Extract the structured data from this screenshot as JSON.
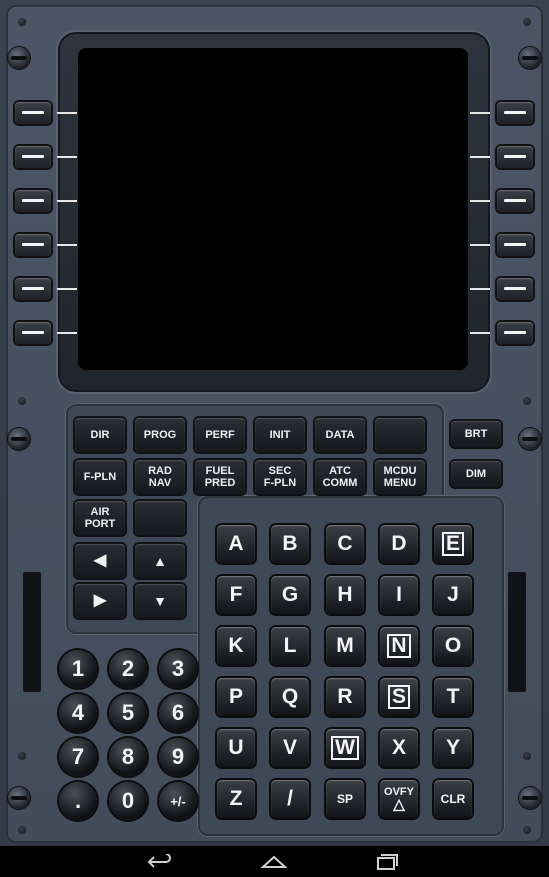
{
  "function_keys": [
    {
      "id": "dir",
      "label": "DIR"
    },
    {
      "id": "prog",
      "label": "PROG"
    },
    {
      "id": "perf",
      "label": "PERF"
    },
    {
      "id": "init",
      "label": "INIT"
    },
    {
      "id": "data",
      "label": "DATA"
    },
    {
      "id": "blank1",
      "label": ""
    },
    {
      "id": "fpln",
      "label": "F-PLN"
    },
    {
      "id": "radnav",
      "label": "RAD\nNAV"
    },
    {
      "id": "fuelpred",
      "label": "FUEL\nPRED"
    },
    {
      "id": "secfpln",
      "label": "SEC\nF-PLN"
    },
    {
      "id": "atccomm",
      "label": "ATC\nCOMM"
    },
    {
      "id": "mcdumenu",
      "label": "MCDU\nMENU"
    },
    {
      "id": "airport",
      "label": "AIR\nPORT"
    },
    {
      "id": "blank2",
      "label": ""
    }
  ],
  "brt_label": "BRT",
  "dim_label": "DIM",
  "arrows": {
    "left": "◀",
    "right": "▶",
    "up": "▲",
    "down": "▼"
  },
  "alpha_keys": [
    "A",
    "B",
    "C",
    "D",
    "E",
    "F",
    "G",
    "H",
    "I",
    "J",
    "K",
    "L",
    "M",
    "N",
    "O",
    "P",
    "Q",
    "R",
    "S",
    "T",
    "U",
    "V",
    "W",
    "X",
    "Y",
    "Z",
    "/",
    "SP",
    "OVFY",
    "CLR"
  ],
  "numeric_keys": [
    "1",
    "2",
    "3",
    "4",
    "5",
    "6",
    "7",
    "8",
    "9",
    ".",
    "0",
    "+/-"
  ],
  "nav_icons": [
    "back-icon",
    "home-icon",
    "recents-icon"
  ]
}
